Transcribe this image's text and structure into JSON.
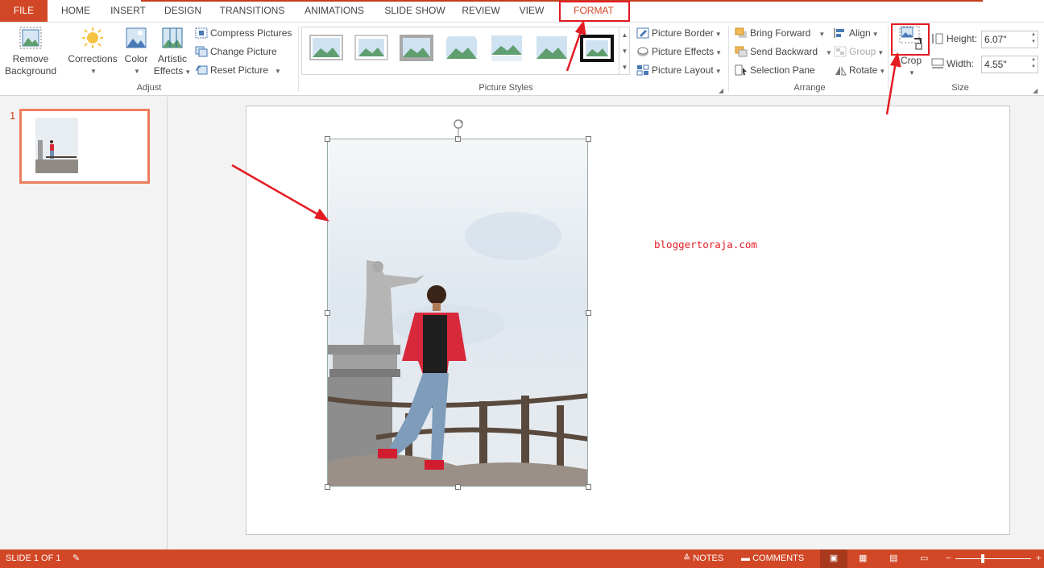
{
  "tabs": [
    {
      "label": "FILE"
    },
    {
      "label": "HOME"
    },
    {
      "label": "INSERT"
    },
    {
      "label": "DESIGN"
    },
    {
      "label": "TRANSITIONS"
    },
    {
      "label": "ANIMATIONS"
    },
    {
      "label": "SLIDE SHOW"
    },
    {
      "label": "REVIEW"
    },
    {
      "label": "VIEW"
    },
    {
      "label": "FORMAT"
    }
  ],
  "ribbon": {
    "remove_background": [
      "Remove",
      "Background"
    ],
    "corrections": "Corrections",
    "color": "Color",
    "artistic_effects": [
      "Artistic",
      "Effects"
    ],
    "compress": "Compress Pictures",
    "change_picture": "Change Picture",
    "reset_picture": "Reset Picture",
    "adjust_label": "Adjust",
    "picture_styles_label": "Picture Styles",
    "picture_border": "Picture Border",
    "picture_effects": "Picture Effects",
    "picture_layout": "Picture Layout",
    "bring_forward": "Bring Forward",
    "send_backward": "Send Backward",
    "selection_pane": "Selection Pane",
    "align": "Align",
    "group": "Group",
    "rotate": "Rotate",
    "arrange_label": "Arrange",
    "crop": "Crop",
    "height_label": "Height:",
    "height_value": "6.07\"",
    "width_label": "Width:",
    "width_value": "4.55\"",
    "size_label": "Size"
  },
  "slides_pane": {
    "slide_number": "1"
  },
  "slide": {
    "watermark_text": "bloggertoraja.com"
  },
  "status": {
    "slide_info": "SLIDE 1 OF 1",
    "notes": "NOTES",
    "comments": "COMMENTS",
    "zoom_minus": "−",
    "zoom_plus": "+"
  },
  "colors": {
    "accent": "#d24726",
    "annotation": "#e31b23"
  }
}
